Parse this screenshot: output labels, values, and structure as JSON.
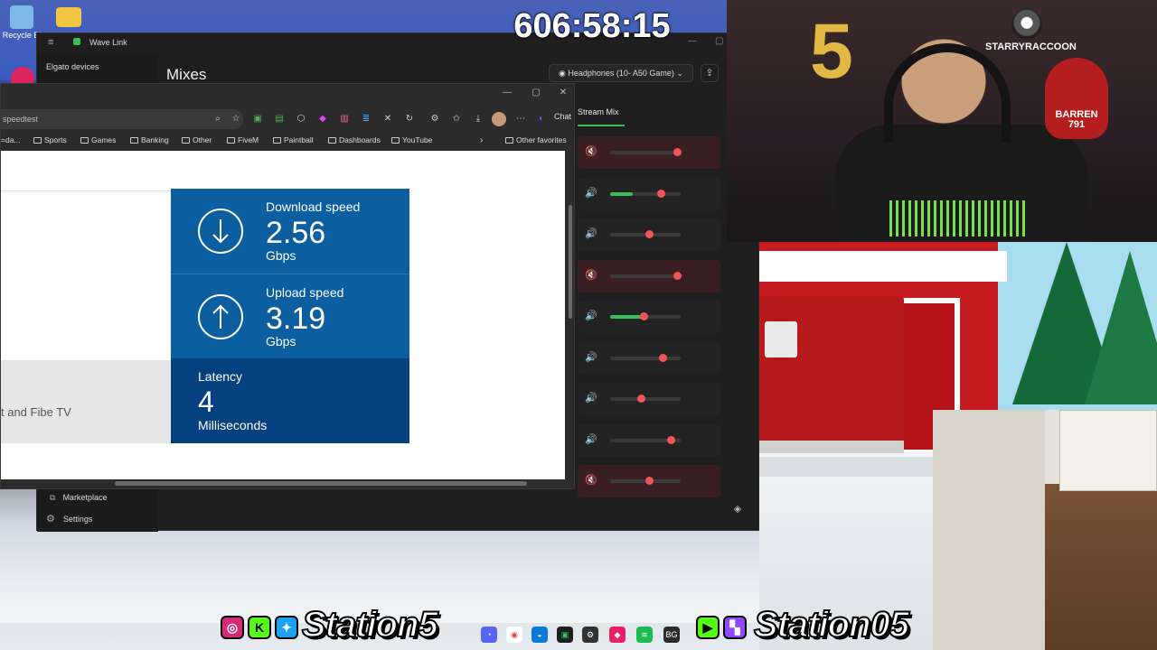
{
  "desktop": {
    "recycle_bin_label": "Recycle Bi"
  },
  "timer": {
    "text": "606:58:15"
  },
  "wave_link": {
    "app_title": "Wave Link",
    "sidebar_heading": "Elgato devices",
    "page_title": "Mixes",
    "output_device": "Headphones (10- A50 Game)",
    "stream_mix_label": "Stream Mix",
    "marketplace_label": "Marketplace",
    "settings_label": "Settings",
    "channels": [
      {
        "muted": true,
        "level": 0.0,
        "fader": 0.95
      },
      {
        "muted": false,
        "level": 0.32,
        "fader": 0.72
      },
      {
        "muted": false,
        "level": 0.0,
        "fader": 0.55
      },
      {
        "muted": true,
        "level": 0.0,
        "fader": 0.95
      },
      {
        "muted": false,
        "level": 0.45,
        "fader": 0.48
      },
      {
        "muted": false,
        "level": 0.0,
        "fader": 0.74
      },
      {
        "muted": false,
        "level": 0.0,
        "fader": 0.43
      },
      {
        "muted": false,
        "level": 0.0,
        "fader": 0.86
      },
      {
        "muted": true,
        "level": 0.0,
        "fader": 0.55
      }
    ],
    "accent_color": "#35c25a",
    "fader_color": "#f2545b"
  },
  "browser": {
    "address_text": "speedtest",
    "chat_label": "Chat",
    "bookmarks_overflow": "=da...",
    "bookmarks": [
      "Sports",
      "Games",
      "Banking",
      "Other",
      "FiveM",
      "Paintball",
      "Dashboards",
      "YouTube"
    ],
    "other_favorites": "Other favorites",
    "content_side_text": "t and Fibe TV",
    "download": {
      "label": "Download speed",
      "value": "2.56",
      "unit": "Gbps",
      "icon": "arrow-down-icon"
    },
    "upload": {
      "label": "Upload speed",
      "value": "3.19",
      "unit": "Gbps",
      "icon": "arrow-up-icon"
    },
    "latency": {
      "label": "Latency",
      "value": "4",
      "unit": "Milliseconds"
    },
    "card_color": "#0b5ea0",
    "latency_card_color": "#05417f"
  },
  "webcam": {
    "badge_starry": "STARRYRACCOON",
    "badge_barren": "BARREN",
    "badge_barren_num": "791"
  },
  "social": {
    "left_handle": "Station5",
    "right_handle": "Station05"
  }
}
